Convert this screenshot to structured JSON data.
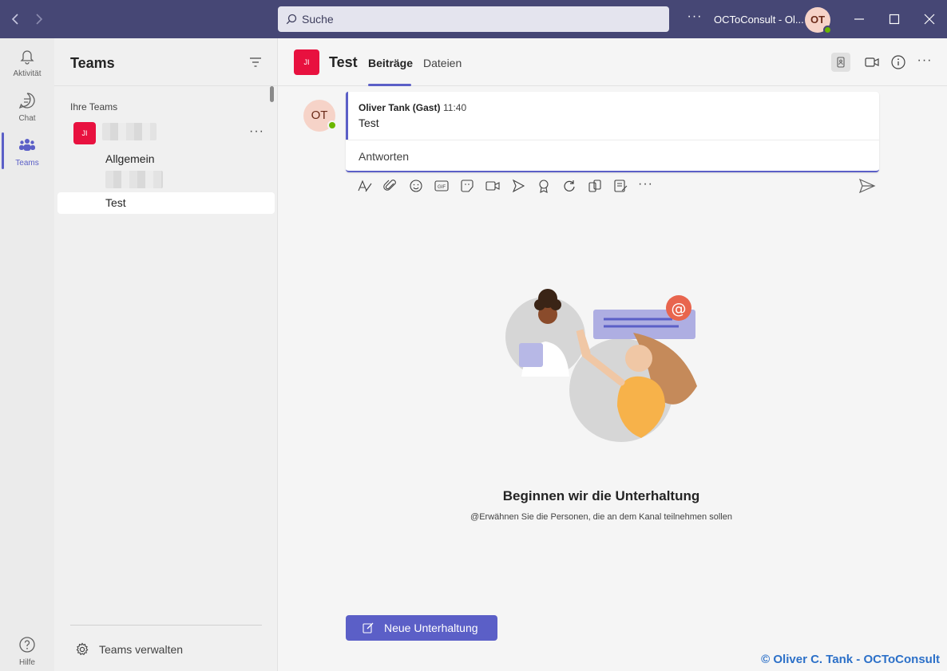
{
  "titlebar": {
    "search_placeholder": "Suche",
    "org_name": "OCToConsult - Ol...",
    "avatar_initials": "OT",
    "more_label": "···"
  },
  "appbar": {
    "items": [
      {
        "label": "Aktivität",
        "icon": "bell-icon"
      },
      {
        "label": "Chat",
        "icon": "chat-icon"
      },
      {
        "label": "Teams",
        "icon": "teams-icon",
        "active": true
      }
    ],
    "help_label": "Hilfe"
  },
  "teams_panel": {
    "title": "Teams",
    "section_label": "Ihre Teams",
    "team_badge": "JI",
    "channels": [
      {
        "label": "Allgemein"
      },
      {
        "label": "Test",
        "selected": true
      }
    ],
    "more_label": "···",
    "manage_label": "Teams verwalten"
  },
  "channel": {
    "badge": "JI",
    "title": "Test",
    "tabs": [
      {
        "label": "Beiträge",
        "active": true
      },
      {
        "label": "Dateien"
      }
    ],
    "more_label": "···"
  },
  "post": {
    "avatar_initials": "OT",
    "author": "Oliver Tank (Gast)",
    "time": "11:40",
    "text": "Test",
    "reply_label": "Antworten"
  },
  "composer_toolbar": {
    "icons": [
      "format-icon",
      "attach-icon",
      "emoji-icon",
      "gif-icon",
      "sticker-icon",
      "meet-icon",
      "stream-icon",
      "praise-icon",
      "loop-icon",
      "apps-icon",
      "notes-icon",
      "more-options-icon"
    ],
    "more_label": "···"
  },
  "empty_state": {
    "title": "Beginnen wir die Unterhaltung",
    "subtitle": "@Erwähnen Sie die Personen, die an dem Kanal teilnehmen sollen",
    "mention_symbol": "@"
  },
  "new_conversation_label": "Neue Unterhaltung",
  "watermark": "© Oliver C. Tank - OCToConsult",
  "colors": {
    "titlebar": "#464775",
    "accent": "#5b5fc7",
    "team_badge": "#e8113f",
    "presence": "#6bb700"
  }
}
